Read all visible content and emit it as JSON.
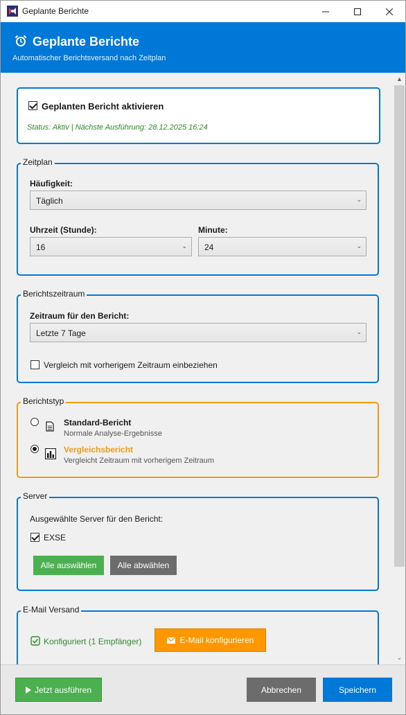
{
  "window": {
    "title": "Geplante Berichte",
    "controls": {
      "minimize": "minimize",
      "maximize": "maximize",
      "close": "close"
    }
  },
  "header": {
    "title": "Geplante Berichte",
    "subtitle": "Automatischer Berichtsversand nach Zeitplan",
    "icon": "alarm-clock-icon",
    "color": "#0078d7"
  },
  "activation": {
    "checkbox_label": "Geplanten Bericht aktivieren",
    "checked": true,
    "status": "Status: Aktiv | Nächste Ausführung: 28.12.2025 16:24",
    "status_color": "#2e8b2e"
  },
  "schedule": {
    "legend": "Zeitplan",
    "frequency_label": "Häufigkeit:",
    "frequency_value": "Täglich",
    "hour_label": "Uhrzeit (Stunde):",
    "hour_value": "16",
    "minute_label": "Minute:",
    "minute_value": "24"
  },
  "period": {
    "legend": "Berichtszeitraum",
    "range_label": "Zeitraum für den Bericht:",
    "range_value": "Letzte 7 Tage",
    "compare_label": "Vergleich mit vorherigem Zeitraum einbeziehen",
    "compare_checked": false
  },
  "report_type": {
    "legend": "Berichtstyp",
    "accent": "#f39c12",
    "options": [
      {
        "title": "Standard-Bericht",
        "desc": "Normale Analyse-Ergebnisse",
        "selected": false,
        "icon": "document-icon"
      },
      {
        "title": "Vergleichsbericht",
        "desc": "Vergleicht Zeitraum mit vorherigem Zeitraum",
        "selected": true,
        "icon": "bar-chart-icon"
      }
    ]
  },
  "server": {
    "legend": "Server",
    "label": "Ausgewählte Server für den Bericht:",
    "items": [
      {
        "name": "EXSE",
        "checked": true
      }
    ],
    "select_all": "Alle auswählen",
    "deselect_all": "Alle abwählen"
  },
  "email": {
    "legend": "E-Mail Versand",
    "configured": "Konfiguriert (1 Empfänger)",
    "configure_button": "E-Mail konfigurieren"
  },
  "footer": {
    "run_now": "Jetzt ausführen",
    "cancel": "Abbrechen",
    "save": "Speichern"
  }
}
